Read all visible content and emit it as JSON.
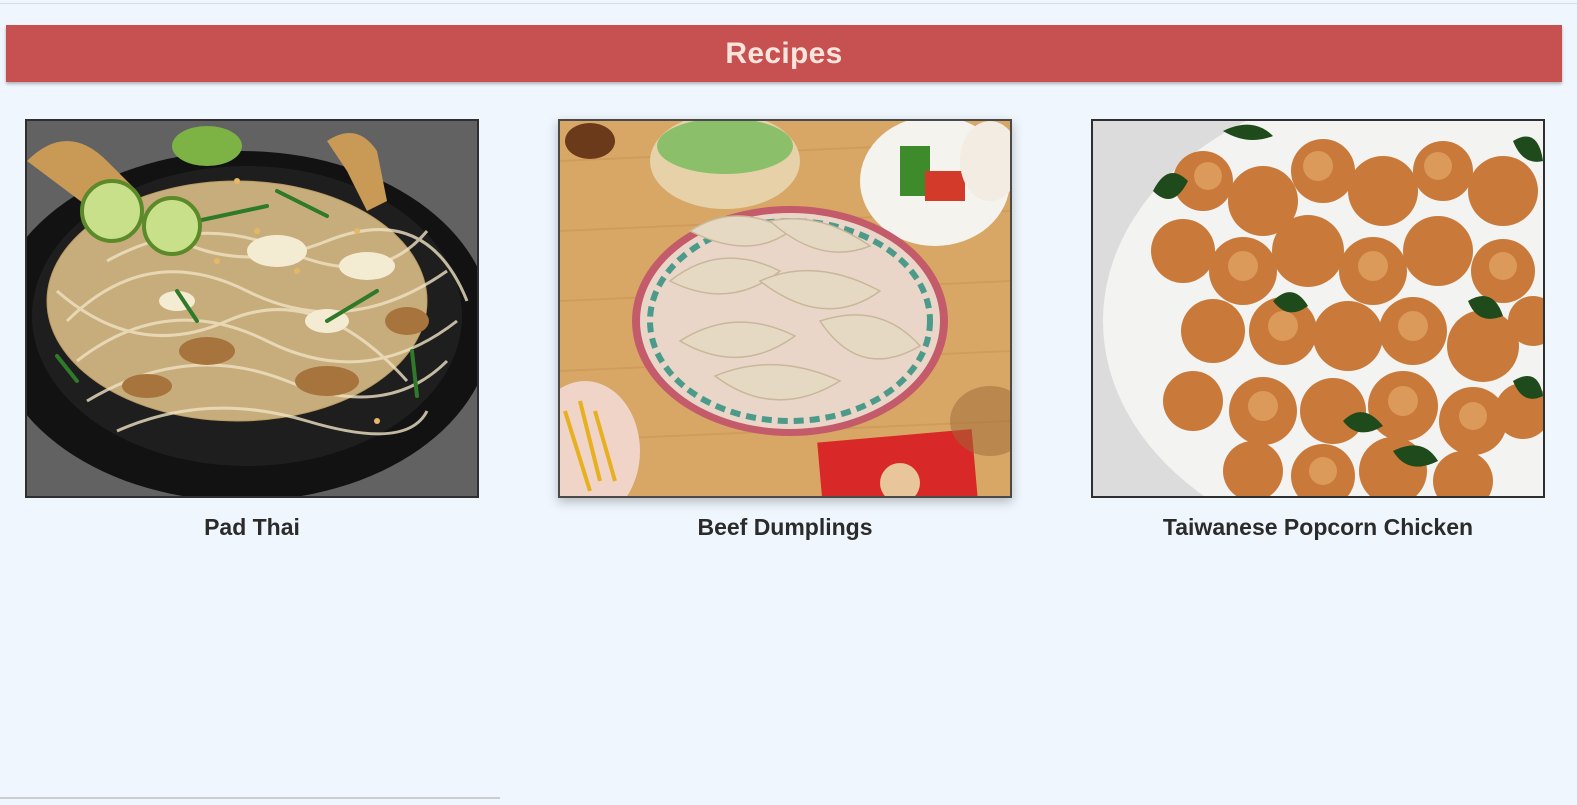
{
  "header": {
    "title": "Recipes"
  },
  "recipes": [
    {
      "name": "Pad Thai",
      "image": "pad-thai-photo"
    },
    {
      "name": "Beef Dumplings",
      "image": "beef-dumplings-photo"
    },
    {
      "name": "Taiwanese Popcorn Chicken",
      "image": "popcorn-chicken-photo"
    }
  ],
  "colors": {
    "page_background": "#eff6fd",
    "header_background": "#c75050",
    "header_text": "#fbe4dc",
    "caption_text": "#2b2b2b"
  }
}
